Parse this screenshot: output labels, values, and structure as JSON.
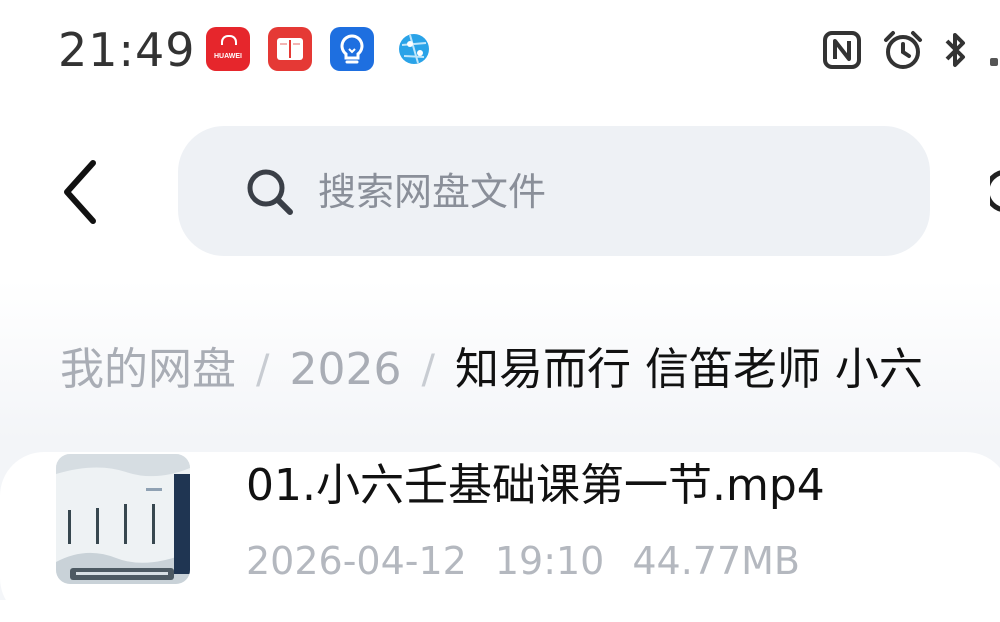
{
  "status_bar": {
    "time": "21:49",
    "notification_icons": [
      {
        "name": "huawei-appgallery-icon",
        "label": "HUAWEI"
      },
      {
        "name": "book-app-icon"
      },
      {
        "name": "lightbulb-app-icon"
      },
      {
        "name": "network-globe-icon"
      }
    ],
    "system_icons": [
      "nfc-icon",
      "alarm-icon",
      "bluetooth-icon"
    ]
  },
  "search": {
    "placeholder": "搜索网盘文件",
    "value": ""
  },
  "breadcrumb": {
    "items": [
      "我的网盘",
      "2026",
      "知易而行 信笛老师 小六"
    ],
    "separator": "/"
  },
  "files": [
    {
      "name": "01.小六壬基础课第一节.mp4",
      "date": "2026-04-12",
      "time": "19:10",
      "size": "44.77MB"
    }
  ],
  "colors": {
    "search_bg": "#eef1f5",
    "breadcrumb_link": "#a9adb5",
    "meta_text": "#b4b8bf",
    "huawei_red": "#e6262c",
    "bulb_blue": "#1e6fe0"
  }
}
